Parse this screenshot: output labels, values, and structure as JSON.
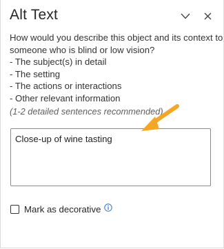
{
  "pane": {
    "title": "Alt Text",
    "collapse_icon": "chevron-down-icon",
    "close_icon": "close-icon"
  },
  "description": {
    "line1": "How would you describe this object and its context to",
    "line2": "someone who is blind or low vision?",
    "bullets": [
      "- The subject(s) in detail",
      "- The setting",
      "- The actions or interactions",
      "- Other relevant information"
    ]
  },
  "hint": "(1-2 detailed sentences recommended)",
  "alt_text_field": {
    "value": "Close-up of wine tasting"
  },
  "decorative": {
    "label": "Mark as decorative",
    "checked": false,
    "info_icon": "info-icon"
  },
  "colors": {
    "annotation_arrow": "#f5a623",
    "info_icon": "#2f6fd1"
  }
}
